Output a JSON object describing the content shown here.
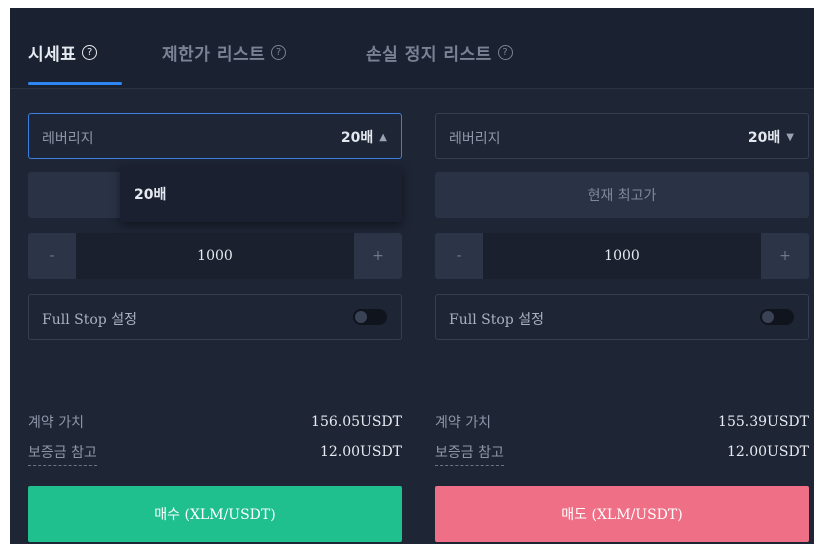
{
  "tabs": [
    {
      "label": "시세표",
      "active": true
    },
    {
      "label": "제한가 리스트",
      "active": false
    },
    {
      "label": "손실 정지 리스트",
      "active": false
    }
  ],
  "help_glyph": "?",
  "left": {
    "leverage_label": "레버리지",
    "leverage_value": "20배",
    "leverage_caret": "▲",
    "dropdown_option": "20배",
    "price_button": "",
    "qty_minus": "-",
    "qty_value": "1000",
    "qty_plus": "+",
    "full_stop_label": "Full Stop 설정",
    "contract_value_label": "계약 가치",
    "contract_value": "156.05USDT",
    "margin_label": "보증금 참고",
    "margin_value": "12.00USDT",
    "action_label": "매수 (XLM/USDT)"
  },
  "right": {
    "leverage_label": "레버리지",
    "leverage_value": "20배",
    "leverage_caret": "▼",
    "price_button": "현재 최고가",
    "qty_minus": "-",
    "qty_value": "1000",
    "qty_plus": "+",
    "full_stop_label": "Full Stop 설정",
    "contract_value_label": "계약 가치",
    "contract_value": "155.39USDT",
    "margin_label": "보증금 참고",
    "margin_value": "12.00USDT",
    "action_label": "매도 (XLM/USDT)"
  },
  "colors": {
    "accent": "#2e86f5",
    "buy": "#1fc08d",
    "sell": "#ef6f86",
    "panel_bg": "#1e2535"
  },
  "toggles": {
    "left_full_stop_on": false,
    "right_full_stop_on": false
  }
}
